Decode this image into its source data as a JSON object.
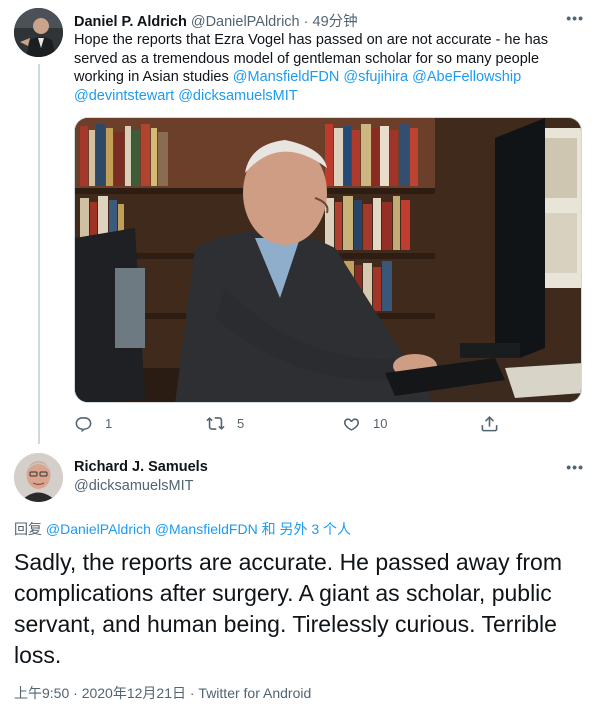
{
  "tweet1": {
    "name": "Daniel P. Aldrich",
    "handle": "@DanielPAldrich",
    "sep": " · ",
    "time": "49分钟",
    "text_main": "Hope the reports that Ezra Vogel has passed on are not accurate - he has served as a tremendous model of gentleman scholar for so many people working in Asian studies ",
    "mentions": [
      "@MansfieldFDN",
      "@sfujihira",
      "@AbeFellowship",
      "@devintstewart",
      "@dicksamuelsMIT"
    ],
    "more_icon": "more-icon",
    "actions": {
      "reply_count": "1",
      "retweet_count": "5",
      "like_count": "10"
    }
  },
  "tweet2": {
    "name": "Richard J. Samuels",
    "handle": "@dicksamuelsMIT",
    "reply_prefix": "回复 ",
    "reply_mentions": "@DanielPAldrich @MansfieldFDN",
    "reply_suffix": " 和 另外 3 个人",
    "text": "Sadly, the reports are accurate. He passed away from complications after surgery.  A giant as scholar, public servant, and human being. Tirelessly curious.  Terrible loss.",
    "meta": "上午9:50 · 2020年12月21日 · Twitter for Android"
  },
  "colors": {
    "link": "#1d9bf0",
    "muted": "#536471",
    "text": "#0f1419"
  }
}
